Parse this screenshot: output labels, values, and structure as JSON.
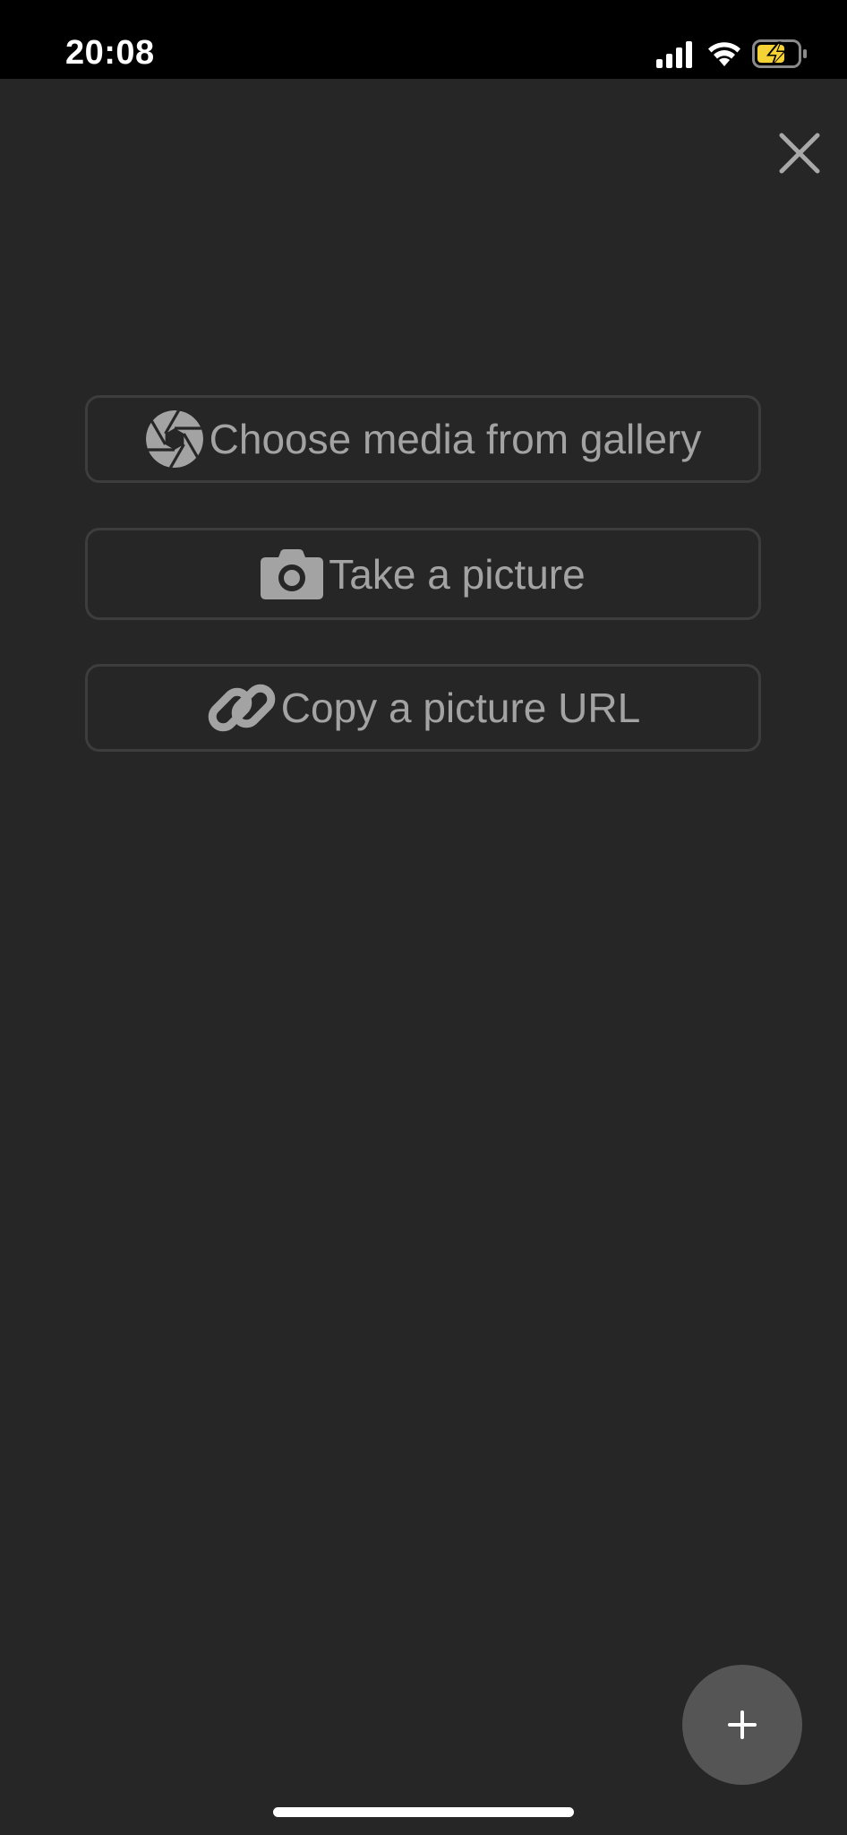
{
  "status_bar": {
    "time": "20:08",
    "icons": [
      "cellular-signal-icon",
      "wifi-icon",
      "battery-charging-icon"
    ],
    "battery_color": "#f5d334"
  },
  "header": {
    "close_icon": "close-icon"
  },
  "options": [
    {
      "label": "Choose media from gallery",
      "icon": "aperture-icon"
    },
    {
      "label": "Take a picture",
      "icon": "camera-icon"
    },
    {
      "label": "Copy a picture URL",
      "icon": "link-icon"
    }
  ],
  "fab": {
    "icon": "plus-icon"
  },
  "colors": {
    "background": "#262626",
    "button_border": "#3d3d3d",
    "button_text": "#a3a3a3",
    "fab_background": "#555555"
  }
}
